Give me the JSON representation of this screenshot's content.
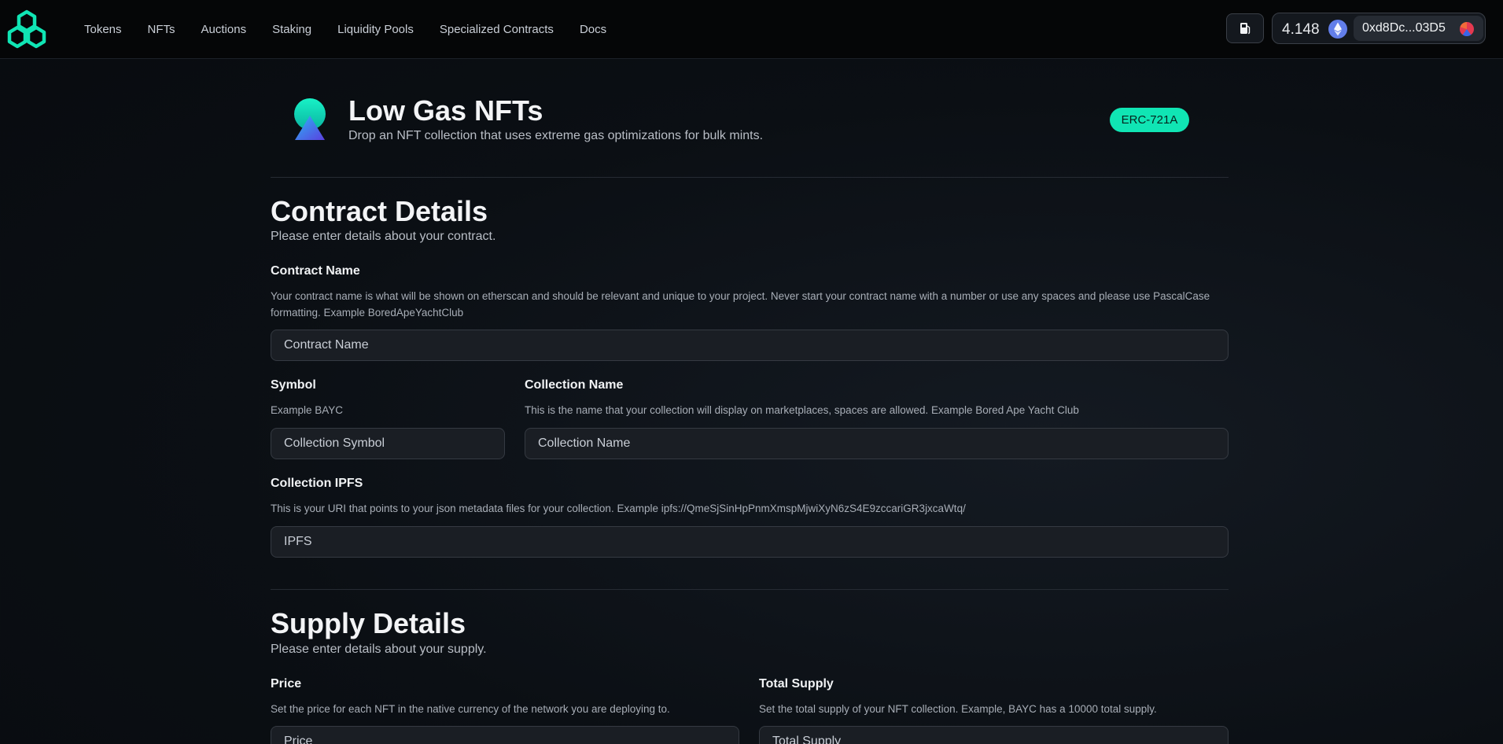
{
  "nav": {
    "links": [
      "Tokens",
      "NFTs",
      "Auctions",
      "Staking",
      "Liquidity Pools",
      "Specialized Contracts",
      "Docs"
    ],
    "balance": "4.148",
    "address": "0xd8Dc...03D5"
  },
  "header": {
    "title": "Low Gas NFTs",
    "subtitle": "Drop an NFT collection that uses extreme gas optimizations for bulk mints.",
    "badge": "ERC-721A"
  },
  "contract": {
    "title": "Contract Details",
    "subtitle": "Please enter details about your contract.",
    "name": {
      "label": "Contract Name",
      "help": "Your contract name is what will be shown on etherscan and should be relevant and unique to your project. Never start your contract name with a number or use any spaces and please use PascalCase formatting. Example BoredApeYachtClub",
      "placeholder": "Contract Name"
    },
    "symbol": {
      "label": "Symbol",
      "help": "Example BAYC",
      "placeholder": "Collection Symbol"
    },
    "collection": {
      "label": "Collection Name",
      "help": "This is the name that your collection will display on marketplaces, spaces are allowed. Example Bored Ape Yacht Club",
      "placeholder": "Collection Name"
    },
    "ipfs": {
      "label": "Collection IPFS",
      "help": "This is your URI that points to your json metadata files for your collection. Example ipfs://QmeSjSinHpPnmXmspMjwiXyN6zS4E9zccariGR3jxcaWtq/",
      "placeholder": "IPFS"
    }
  },
  "supply": {
    "title": "Supply Details",
    "subtitle": "Please enter details about your supply.",
    "price": {
      "label": "Price",
      "help": "Set the price for each NFT in the native currency of the network you are deploying to.",
      "placeholder": "Price"
    },
    "total": {
      "label": "Total Supply",
      "help": "Set the total supply of your NFT collection. Example, BAYC has a 10000 total supply.",
      "placeholder": "Total Supply"
    }
  },
  "colors": {
    "accent": "#10e5b4",
    "background": "#0b0f14"
  }
}
